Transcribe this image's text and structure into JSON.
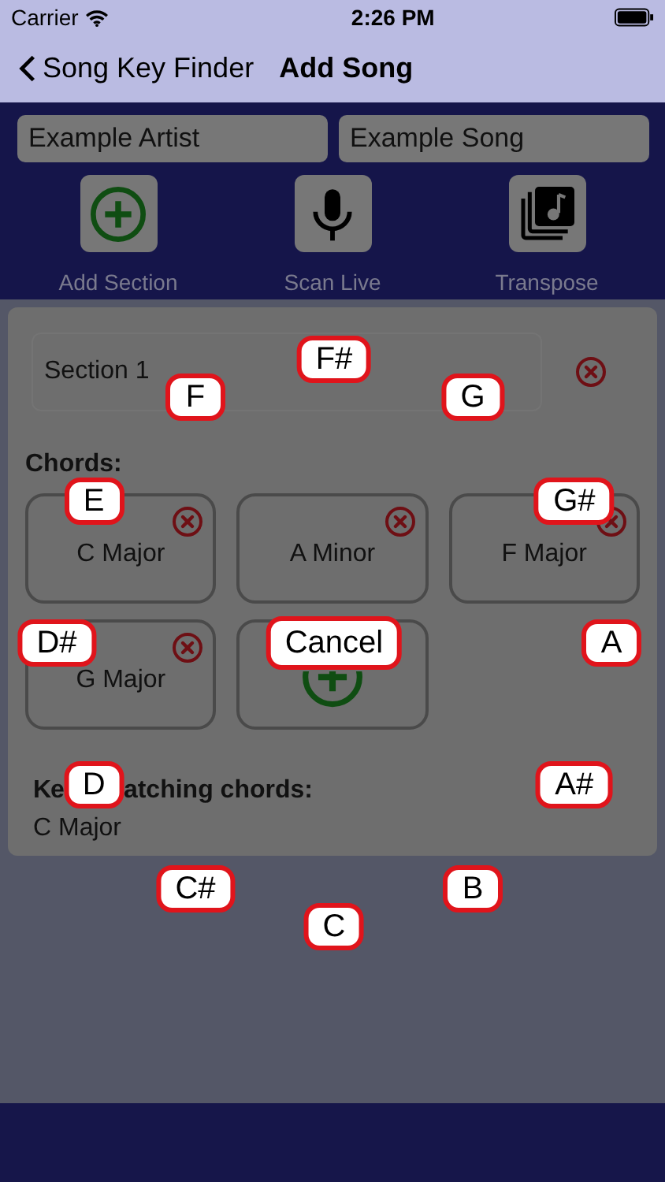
{
  "status_bar": {
    "carrier": "Carrier",
    "time": "2:26 PM"
  },
  "nav": {
    "back": "Song Key Finder",
    "title": "Add Song"
  },
  "fields": [
    {
      "value": "Example Artist"
    },
    {
      "value": "Example Song"
    }
  ],
  "toolbar": [
    {
      "kind": "add",
      "label": "Add Section"
    },
    {
      "kind": "mic",
      "label": "Scan Live"
    },
    {
      "kind": "transpose",
      "label": "Transpose"
    }
  ],
  "section": {
    "name": "Section 1",
    "chords_label": "Chords:",
    "chords": [
      "C Major",
      "A Minor",
      "F Major",
      "G Major"
    ],
    "key_label": [
      "Ke",
      "atching chords:"
    ],
    "key": "C Major"
  },
  "key_picker": {
    "keys": [
      "F#",
      "G",
      "G#",
      "A",
      "A#",
      "B",
      "C",
      "C#",
      "D",
      "D#",
      "E",
      "F"
    ],
    "cancel": "Cancel"
  }
}
